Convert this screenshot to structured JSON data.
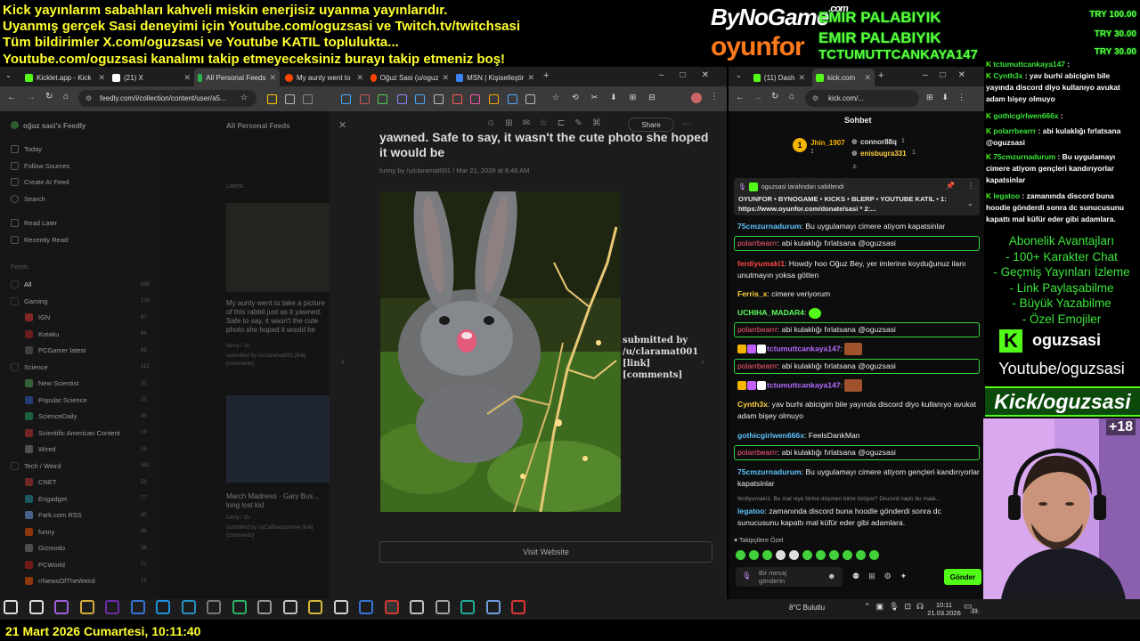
{
  "overlay": {
    "ticker_lines": [
      "Kick yayınlarım sabahları kahveli miskin enerjisiz uyanma yayınlarıdır.",
      "Uyanmış gerçek Sasi deneyimi için Youtube.com/oguzsasi ve Twitch.tv/twitchsasi",
      "Tüm bildirimler X.com/oguzsasi ve Youtube KATIL toplulukta...",
      "Youtube.com/oguzsasi kanalımı takip etmeyeceksiniz burayı takip etmeniz boş!"
    ],
    "sponsor_1": "ByNoGame",
    "sponsor_1_suffix": ".com",
    "sponsor_2": "oyunfor",
    "donors": [
      "EMIR PALABIYIK",
      "EMIR PALABIYIK",
      "TCTUMUTTCANKAYA147"
    ],
    "donations": [
      "TRY 100.00",
      "TRY 30.00",
      "TRY 30.00"
    ],
    "bottom_date": "21 Mart 2026 Cumartesi, 10:11:40",
    "benefits_title": "Abonelik Avantajları",
    "benefits": [
      "- 100+ Karakter Chat",
      "- Geçmiş Yayınları İzleme",
      "- Link Paylaşabilme",
      "- Büyük Yazabilme",
      "- Özel Emojiler"
    ],
    "kick_handle": "oguzsasi",
    "youtube_handle": "Youtube/oguzsasi",
    "kick_banner": "Kick/oguzsasi",
    "cam_badge": "+18"
  },
  "left_browser": {
    "tabs": [
      {
        "label": "Kicklet.app - Kick",
        "color": "#53fc18"
      },
      {
        "label": "(21) X",
        "color": "#ffffff"
      },
      {
        "label": "All Personal Feeds",
        "color": "#2bb24c"
      },
      {
        "label": "My aunty went to",
        "color": "#ff4500"
      },
      {
        "label": "Oğuz Sasi (u/oguz",
        "color": "#ff4500"
      },
      {
        "label": "MSN | Kişiselleştir",
        "color": "#3b82f6"
      }
    ],
    "url": "feedly.com/i/collection/content/user/a5...",
    "sidebar_title": "oğuz sasi's Feedly",
    "nav": [
      "Today",
      "Follow Sources",
      "Create AI Feed",
      "Search",
      "Read Later",
      "Recently Read"
    ],
    "feeds_header": "Feeds",
    "feeds": [
      {
        "label": "All",
        "count": "999"
      },
      {
        "label": "Gaming",
        "count": "216"
      },
      {
        "label": "IGN",
        "count": "87"
      },
      {
        "label": "Kotaku",
        "count": "64"
      },
      {
        "label": "PCGamer latest",
        "count": "65"
      },
      {
        "label": "Science",
        "count": "112"
      },
      {
        "label": "New Scientist",
        "count": "31"
      },
      {
        "label": "Popular Science",
        "count": "22"
      },
      {
        "label": "ScienceDaily",
        "count": "40"
      },
      {
        "label": "Scientific American Content",
        "count": "19"
      },
      {
        "label": "Wired",
        "count": "28"
      },
      {
        "label": "Tech / Weird",
        "count": "341"
      },
      {
        "label": "CNET",
        "count": "58"
      },
      {
        "label": "Engadget",
        "count": "77"
      },
      {
        "label": "Fark.com RSS",
        "count": "90"
      },
      {
        "label": "funny",
        "count": "44"
      },
      {
        "label": "Gizmodo",
        "count": "36"
      },
      {
        "label": "PCWorld",
        "count": "21"
      },
      {
        "label": "r/NewsOfTheWeird",
        "count": "15"
      }
    ],
    "list_title": "All Personal Feeds",
    "latest": "Latest",
    "card1_title": "My aunty went to take a picture of this rabbit just as it yawned. Safe to say, it wasn't the cute photo she hoped it would be",
    "card1_meta": "funny / 1h",
    "card1_sub": "submitted by /u/claramat001 [link] [comments]",
    "card2_title": "March Madness - Gary Bus... long lost kid",
    "card2_meta": "funny / 1h",
    "card2_sub": "submitted by /u/Caffeacupreme [link] [comments]",
    "article_title": "yawned. Safe to say, it wasn't the cute photo she hoped it would be",
    "article_meta": "funny by /u/claramat001 / Mar 21, 2026 at 8:46 AM",
    "article_submitted": "submitted by /u/claramat001 [link] [comments]",
    "share": "Share",
    "visit_btn": "Visit Website"
  },
  "right_browser": {
    "tabs": [
      {
        "label": "(11) Dash"
      },
      {
        "label": "kick.com"
      }
    ],
    "url": "kick.com/...",
    "chat_title": "Sohbet",
    "leaders": [
      {
        "name": "Jhin_1907",
        "count": "1"
      },
      {
        "name": "connor88q",
        "count": "1"
      },
      {
        "name": "enisbugra331",
        "count": "1"
      }
    ],
    "pinned_by": "oguzsasi tarafından sabitlendi",
    "pinned_text": "OYUNFOR • BYNOGAME • KICKS • BLERP • YOUTUBE KATIL • 1: https://www.oyunfor.com/donate/sasi * 2:...",
    "messages": [
      {
        "user": "75cmzurnadurum",
        "text": " Bu uygulamayı cimere atiyom kapatsinlar",
        "color": "#5ec4ff",
        "box": false
      },
      {
        "user": "polarrbearrr",
        "text": " abi kulaklığı fırlatsana @oguzsasi",
        "color": "#ff5b7b",
        "box": true
      },
      {
        "user": "ferdiyumaki1",
        "text": " Howdy hoo Oğuz Bey, yer imlerine koyduğunuz ilanı unutmayın yoksa götten",
        "color": "#ff4545",
        "box": false
      },
      {
        "user": "Ferris_x",
        "text": " cimere veriyorum",
        "color": "#ffd23f",
        "box": false
      },
      {
        "user": "UCHIHA_MADAR4",
        "text": " ",
        "color": "#5cff5c",
        "box": false
      },
      {
        "user": "polarrbearrr",
        "text": " abi kulaklığı fırlatsana @oguzsasi",
        "color": "#ff5b7b",
        "box": true
      },
      {
        "user": "tctumuttcankaya147",
        "text": " ",
        "color": "#b46bff",
        "box": false
      },
      {
        "user": "polarrbearrr",
        "text": " abi kulaklığı fırlatsana @oguzsasi",
        "color": "#ff5b7b",
        "box": true
      },
      {
        "user": "tctumuttcankaya147",
        "text": " ",
        "color": "#b46bff",
        "box": false
      },
      {
        "user": "Cynth3x",
        "text": " yav burhi abicigim bile yayında discord diyo kullanıyo avukat adam bişey olmuyo",
        "color": "#ffd23f",
        "box": false
      },
      {
        "user": "gothicgirlwen666x",
        "text": " FeelsDankMan",
        "color": "#5ec4ff",
        "box": false
      },
      {
        "user": "polarrbearrr",
        "text": " abi kulaklığı fırlatsana @oguzsasi",
        "color": "#ff5b7b",
        "box": true
      },
      {
        "user": "75cmzurnadurum",
        "text": " Bu uygulamayı cimere atiyom gençleri kandırıyorlar kapatsinlar",
        "color": "#5ec4ff",
        "box": false
      }
    ],
    "reply_line": "ferdiyumaki1: Bu mal niye birine düşmen birini övüyor? Discord naptı bu mala...",
    "last_user": "legatoo",
    "last_text": " zamanında discord buna hoodle gönderdi sonra dc sunucusunu kapattı mal küfür eder gibi adamlara.",
    "follower_label": "Takipçilere Özel",
    "input_placeholder": "Bir mesaj gönderin",
    "send": "Gönder"
  },
  "right_chat_overlay": [
    {
      "user": "tctumuttcankaya147",
      "text": " "
    },
    {
      "user": "Cynth3x",
      "text": " yav burhi abicigim bile yayında discord diyo kullanıyo avukat adam bişey olmuyo"
    },
    {
      "user": "gothicgirlwen666x",
      "text": " "
    },
    {
      "user": "polarrbearrr",
      "text": " abi kulaklığı fırlatsana @oguzsasi"
    },
    {
      "user": "75cmzurnadurum",
      "text": " Bu uygulamayı cimere atiyom gençleri kandırıyorlar kapatsinlar"
    },
    {
      "user": "legatoo",
      "text": " zamanında discord buna hoodie gönderdi sonra dc sunucusunu kapattı mal küfür eder gibi adamlara."
    }
  ],
  "taskbar": {
    "weather": "8°C Bulutlu",
    "time": "10:11",
    "date": "21.03.2026",
    "notif": "21"
  },
  "colors": {
    "kick_green": "#53fc18",
    "ticker_yellow": "#ffff2e",
    "chat_box_border": "#35d43a"
  }
}
